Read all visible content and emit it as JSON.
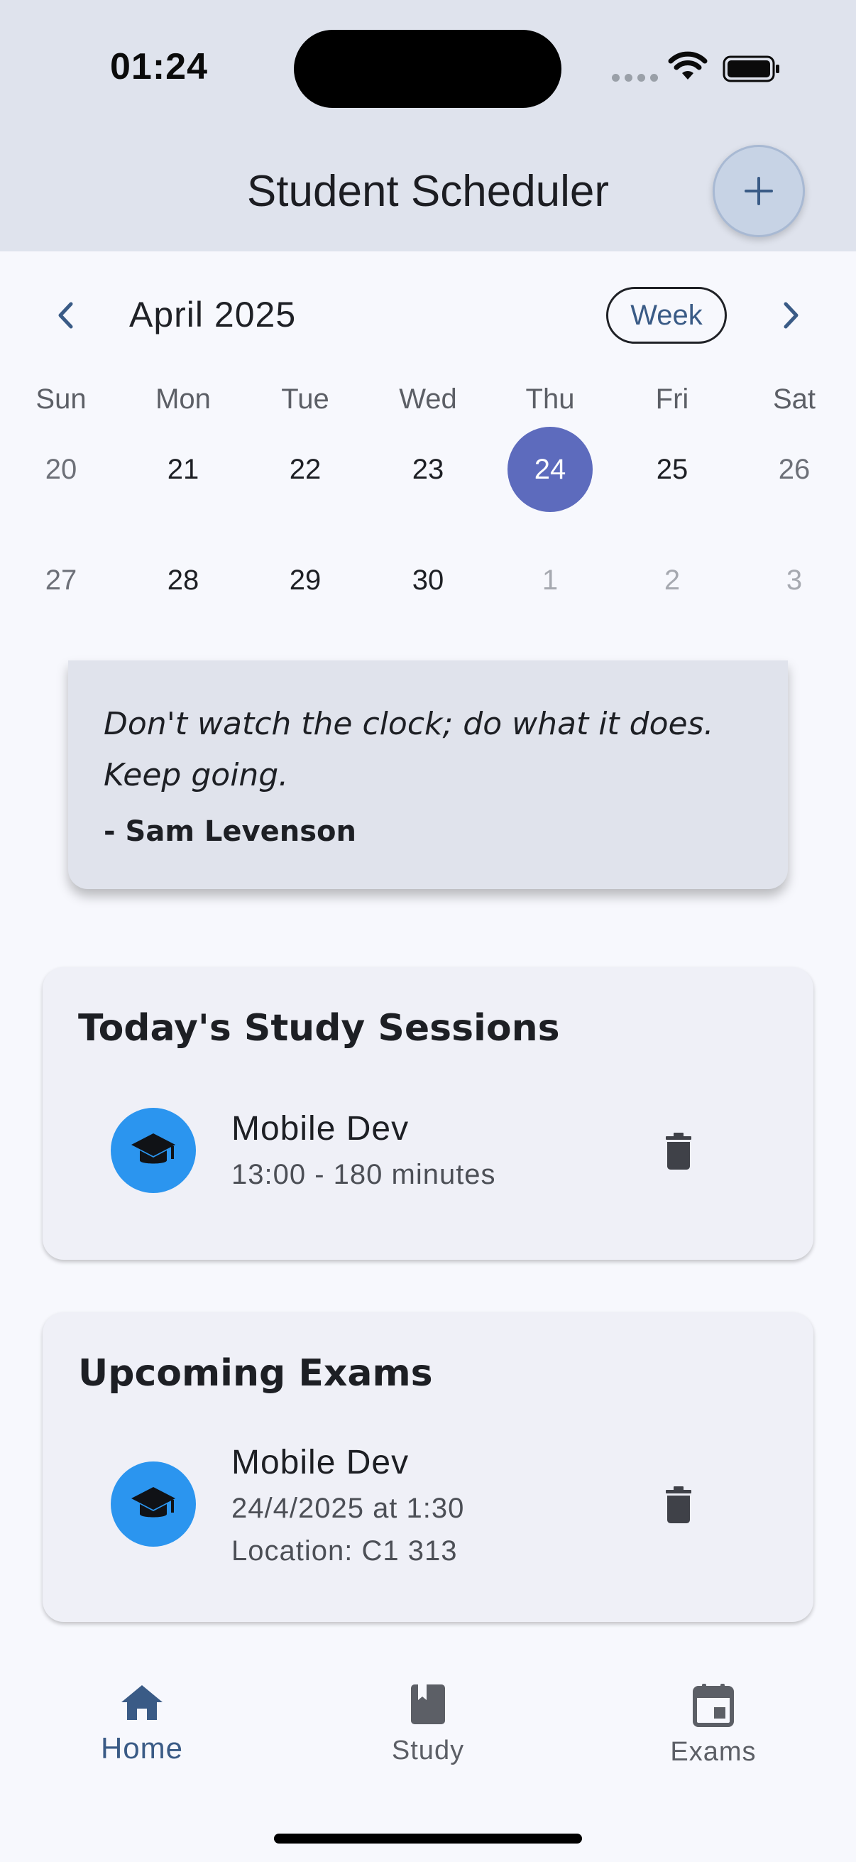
{
  "status_bar": {
    "time": "01:24"
  },
  "header": {
    "title": "Student Scheduler",
    "add_icon": "plus-icon"
  },
  "calendar": {
    "month": "April 2025",
    "view_mode": "Week",
    "weekdays": [
      "Sun",
      "Mon",
      "Tue",
      "Wed",
      "Thu",
      "Fri",
      "Sat"
    ],
    "week1": [
      "20",
      "21",
      "22",
      "23",
      "24",
      "25",
      "26"
    ],
    "week2": [
      "27",
      "28",
      "29",
      "30",
      "1",
      "2",
      "3"
    ],
    "selected_day": "24",
    "selected_color": "#5d6bbd"
  },
  "quote": {
    "text": "Don't watch the clock; do what it does. Keep going.",
    "author": "- Sam Levenson"
  },
  "study_sessions": {
    "title": "Today's Study Sessions",
    "items": [
      {
        "name": "Mobile Dev",
        "detail": "13:00 - 180 minutes",
        "icon": "graduation-cap-icon"
      }
    ]
  },
  "exams": {
    "title": "Upcoming Exams",
    "items": [
      {
        "name": "Mobile Dev",
        "date": "24/4/2025 at 1:30",
        "location": "Location: C1 313",
        "icon": "graduation-cap-icon"
      }
    ]
  },
  "bottom_nav": {
    "items": [
      {
        "label": "Home",
        "icon": "home-icon",
        "active": true
      },
      {
        "label": "Study",
        "icon": "book-icon",
        "active": false
      },
      {
        "label": "Exams",
        "icon": "calendar-icon",
        "active": false
      }
    ]
  },
  "colors": {
    "accent": "#3a5b86",
    "avatar": "#2b95ef",
    "top_bar": "#dfe3ed"
  }
}
